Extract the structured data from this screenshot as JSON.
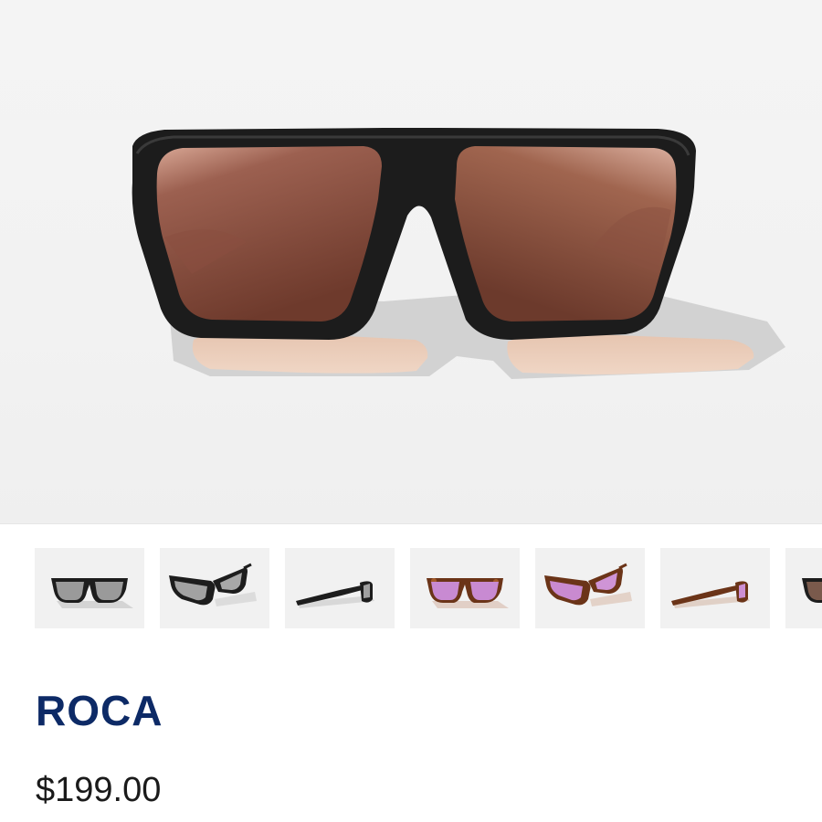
{
  "product": {
    "name": "ROCA",
    "price": "$199.00"
  },
  "hero_image": {
    "frame": "matte-black",
    "lens": "copper",
    "icon": "sunglasses-front-icon"
  },
  "thumbnails": [
    {
      "variant": "black-silver-front",
      "frame": "matte-black",
      "lens": "silver",
      "view": "front"
    },
    {
      "variant": "black-silver-angle",
      "frame": "matte-black",
      "lens": "silver",
      "view": "angle"
    },
    {
      "variant": "black-silver-side",
      "frame": "matte-black",
      "lens": "silver",
      "view": "side"
    },
    {
      "variant": "tortoise-pink-front",
      "frame": "tortoise",
      "lens": "pink",
      "view": "front"
    },
    {
      "variant": "tortoise-pink-angle",
      "frame": "tortoise",
      "lens": "pink",
      "view": "angle"
    },
    {
      "variant": "tortoise-pink-side",
      "frame": "tortoise",
      "lens": "pink",
      "view": "side"
    },
    {
      "variant": "partial-front",
      "frame": "matte-black",
      "lens": "copper",
      "view": "front"
    }
  ],
  "colors": {
    "title": "#0d2a66",
    "price": "#1a1a1a",
    "hero_bg": "#f3f3f3",
    "thumb_bg": "#f1f1f1"
  }
}
